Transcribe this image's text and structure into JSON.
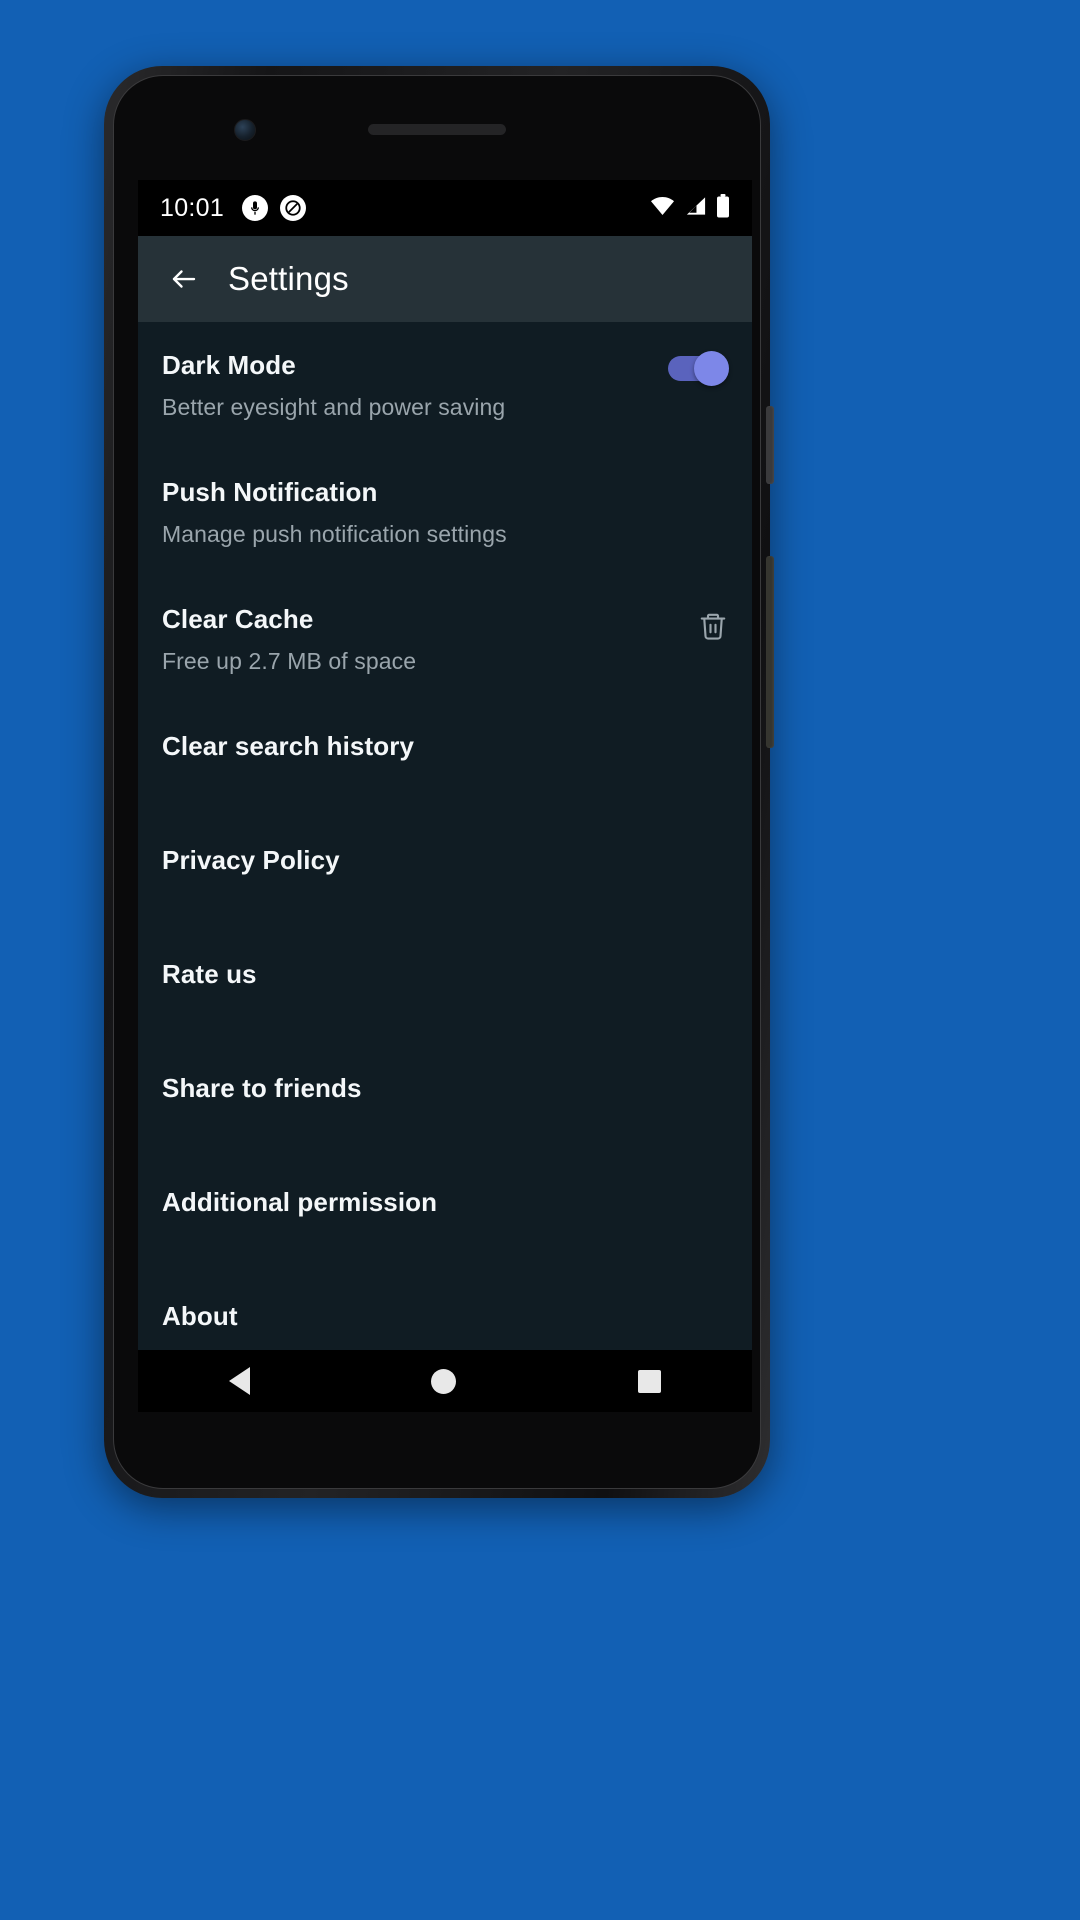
{
  "status_bar": {
    "time": "10:01",
    "left_icons": [
      "microphone-icon",
      "do-not-disturb-icon"
    ],
    "right_icons": [
      "wifi-icon",
      "cellular-signal-icon",
      "battery-icon"
    ]
  },
  "app_bar": {
    "back_icon": "back-arrow-icon",
    "title": "Settings",
    "background_color": "#263238"
  },
  "theme": {
    "page_background": "#1260b4",
    "screen_background": "#101c23",
    "title_color": "#f4f7f9",
    "subtitle_color": "#9aa5ac",
    "toggle_accent": "#7d87e8",
    "toggle_track": "#5a63bd"
  },
  "settings": {
    "items": [
      {
        "title": "Dark Mode",
        "subtitle": "Better eyesight and power saving",
        "control": "toggle",
        "toggle_state": "on"
      },
      {
        "title": "Push Notification",
        "subtitle": "Manage push notification settings",
        "control": "none"
      },
      {
        "title": "Clear Cache",
        "subtitle": "Free up 2.7 MB of space",
        "control": "trash-icon"
      },
      {
        "title": "Clear search history",
        "subtitle": "",
        "control": "none"
      },
      {
        "title": "Privacy Policy",
        "subtitle": "",
        "control": "none"
      },
      {
        "title": "Rate us",
        "subtitle": "",
        "control": "none"
      },
      {
        "title": "Share to friends",
        "subtitle": "",
        "control": "none"
      },
      {
        "title": "Additional permission",
        "subtitle": "",
        "control": "none"
      },
      {
        "title": "About",
        "subtitle": "",
        "control": "none"
      }
    ]
  },
  "nav_bar": {
    "back_label": "back-triangle-icon",
    "home_label": "home-circle-icon",
    "recents_label": "recents-square-icon"
  }
}
